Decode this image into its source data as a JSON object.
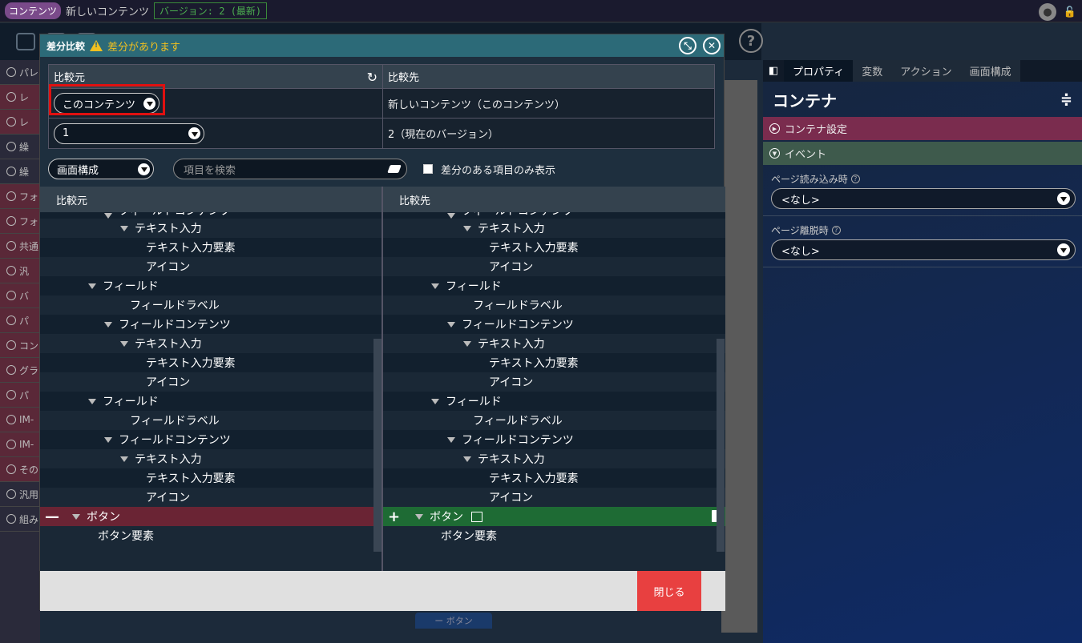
{
  "topbar": {
    "badge": "コンテンツ",
    "title": "新しいコンテンツ",
    "version": "バージョン: 2 (最新)",
    "user_icon": "user-avatar-icon",
    "lock_icon": "lock-icon"
  },
  "left_panel": {
    "items": [
      {
        "label": "パレ",
        "red": false
      },
      {
        "label": "レ",
        "red": true
      },
      {
        "label": "レ",
        "red": true
      },
      {
        "label": "繰",
        "red": false
      },
      {
        "label": "繰",
        "red": false
      },
      {
        "label": "フォ",
        "red": true
      },
      {
        "label": "フォ",
        "red": true
      },
      {
        "label": "共通",
        "red": true
      },
      {
        "label": "汎",
        "red": true
      },
      {
        "label": "バ",
        "red": true
      },
      {
        "label": "パ",
        "red": true
      },
      {
        "label": "コン",
        "red": true
      },
      {
        "label": "グラ",
        "red": true
      },
      {
        "label": "パ",
        "red": true
      },
      {
        "label": "IM-",
        "red": true
      },
      {
        "label": "IM-",
        "red": true
      },
      {
        "label": "その",
        "red": true
      },
      {
        "label": "汎用",
        "red": false
      },
      {
        "label": "組み",
        "red": false
      }
    ]
  },
  "right_panel": {
    "tabs": [
      "プロパティ",
      "変数",
      "アクション",
      "画面構成"
    ],
    "active_tab": 0,
    "title": "コンテナ",
    "section_config": "コンテナ設定",
    "section_event": "イベント",
    "field1_label": "ページ読み込み時",
    "field1_value": "<なし>",
    "field2_label": "ページ離脱時",
    "field2_value": "<なし>"
  },
  "modal": {
    "title": "差分比較",
    "warning": "差分があります",
    "source_header": "比較元",
    "target_header": "比較先",
    "source_content": "このコンテンツ",
    "target_content": "新しいコンテンツ（このコンテンツ）",
    "source_version": "1",
    "target_version": "2（現在のバージョン）",
    "filter_select": "画面構成",
    "search_placeholder": "項目を検索",
    "diff_only_label": "差分のある項目のみ表示",
    "diff_only_checked": false,
    "pane_left_header": "比較元",
    "pane_right_header": "比較先",
    "close_label": "閉じる"
  },
  "tree": {
    "left": [
      {
        "label": "フィールドコンテンツ",
        "indent": 3,
        "caret": true,
        "state": "cut"
      },
      {
        "label": "テキスト入力",
        "indent": 4,
        "caret": true
      },
      {
        "label": "テキスト入力要素",
        "indent": 5,
        "caret": false
      },
      {
        "label": "アイコン",
        "indent": 5,
        "caret": false
      },
      {
        "label": "フィールド",
        "indent": 2,
        "caret": true
      },
      {
        "label": "フィールドラベル",
        "indent": 4,
        "caret": false
      },
      {
        "label": "フィールドコンテンツ",
        "indent": 3,
        "caret": true
      },
      {
        "label": "テキスト入力",
        "indent": 4,
        "caret": true
      },
      {
        "label": "テキスト入力要素",
        "indent": 5,
        "caret": false
      },
      {
        "label": "アイコン",
        "indent": 5,
        "caret": false
      },
      {
        "label": "フィールド",
        "indent": 2,
        "caret": true
      },
      {
        "label": "フィールドラベル",
        "indent": 4,
        "caret": false
      },
      {
        "label": "フィールドコンテンツ",
        "indent": 3,
        "caret": true
      },
      {
        "label": "テキスト入力",
        "indent": 4,
        "caret": true
      },
      {
        "label": "テキスト入力要素",
        "indent": 5,
        "caret": false
      },
      {
        "label": "アイコン",
        "indent": 5,
        "caret": false
      },
      {
        "label": "ボタン",
        "indent": 1,
        "caret": true,
        "state": "del"
      },
      {
        "label": "ボタン要素",
        "indent": 2,
        "caret": false
      }
    ],
    "right": [
      {
        "label": "フィールドコンテンツ",
        "indent": 3,
        "caret": true,
        "state": "cut"
      },
      {
        "label": "テキスト入力",
        "indent": 4,
        "caret": true
      },
      {
        "label": "テキスト入力要素",
        "indent": 5,
        "caret": false
      },
      {
        "label": "アイコン",
        "indent": 5,
        "caret": false
      },
      {
        "label": "フィールド",
        "indent": 2,
        "caret": true
      },
      {
        "label": "フィールドラベル",
        "indent": 4,
        "caret": false
      },
      {
        "label": "フィールドコンテンツ",
        "indent": 3,
        "caret": true
      },
      {
        "label": "テキスト入力",
        "indent": 4,
        "caret": true
      },
      {
        "label": "テキスト入力要素",
        "indent": 5,
        "caret": false
      },
      {
        "label": "アイコン",
        "indent": 5,
        "caret": false
      },
      {
        "label": "フィールド",
        "indent": 2,
        "caret": true
      },
      {
        "label": "フィールドラベル",
        "indent": 4,
        "caret": false
      },
      {
        "label": "フィールドコンテンツ",
        "indent": 3,
        "caret": true
      },
      {
        "label": "テキスト入力",
        "indent": 4,
        "caret": true
      },
      {
        "label": "テキスト入力要素",
        "indent": 5,
        "caret": false
      },
      {
        "label": "アイコン",
        "indent": 5,
        "caret": false
      },
      {
        "label": "ボタン",
        "indent": 1,
        "caret": true,
        "state": "add"
      },
      {
        "label": "ボタン要素",
        "indent": 2,
        "caret": false
      }
    ]
  },
  "colors": {
    "modal_header": "#2c6a78",
    "warning": "#f0c020",
    "deleted_row": "#6a2434",
    "added_row": "#1e6b34",
    "close_button": "#e84040",
    "highlight_box": "#e01010"
  }
}
